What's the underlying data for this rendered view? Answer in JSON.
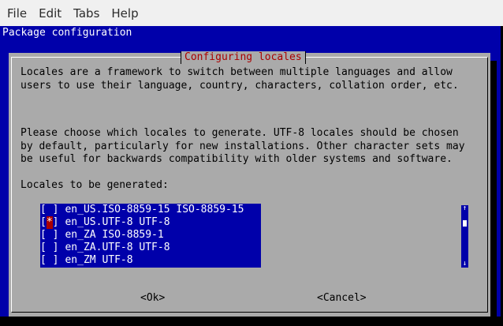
{
  "menubar": {
    "items": [
      "File",
      "Edit",
      "Tabs",
      "Help"
    ]
  },
  "terminal": {
    "backtitle": "Package configuration"
  },
  "dialog": {
    "title": "Configuring locales",
    "description1": "Locales are a framework to switch between multiple languages and allow\nusers to use their language, country, characters, collation order, etc.",
    "description2": "Please choose which locales to generate. UTF-8 locales should be chosen\nby default, particularly for new installations. Other character sets may\nbe useful for backwards compatibility with older systems and software.",
    "list_heading": "Locales to be generated:",
    "locales": [
      {
        "label": "en_US.ISO-8859-15 ISO-8859-15",
        "mark": " ",
        "checked": false
      },
      {
        "label": "en_US.UTF-8 UTF-8",
        "mark": "*",
        "checked": true
      },
      {
        "label": "en_ZA ISO-8859-1",
        "mark": " ",
        "checked": false
      },
      {
        "label": "en_ZA.UTF-8 UTF-8",
        "mark": " ",
        "checked": false
      },
      {
        "label": "en_ZM UTF-8",
        "mark": " ",
        "checked": false
      }
    ],
    "scroll": {
      "up": "↑",
      "down": "↓"
    },
    "ok_label": "<Ok>",
    "cancel_label": "<Cancel>"
  }
}
